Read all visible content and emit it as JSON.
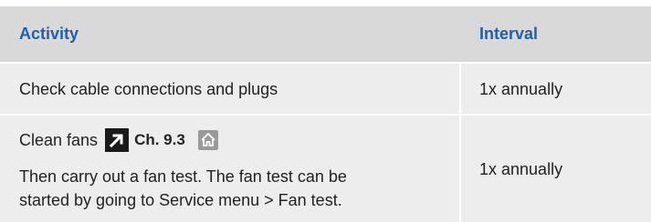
{
  "header": {
    "activity": "Activity",
    "interval": "Interval"
  },
  "rows": [
    {
      "activity": "Check cable connections and plugs",
      "interval": "1x annually"
    },
    {
      "activity_prefix": "Clean fans",
      "reference": "Ch. 9.3",
      "note_line1": "Then carry out a fan test. The fan test can be",
      "note_line2": "started by going to Service menu > Fan test.",
      "interval": "1x annually",
      "icons": [
        "external-reference-arrow-icon",
        "home-icon"
      ]
    }
  ],
  "colors": {
    "header_bg": "#d9d9d9",
    "row_bg": "#ededed",
    "header_text": "#1f5fae"
  }
}
